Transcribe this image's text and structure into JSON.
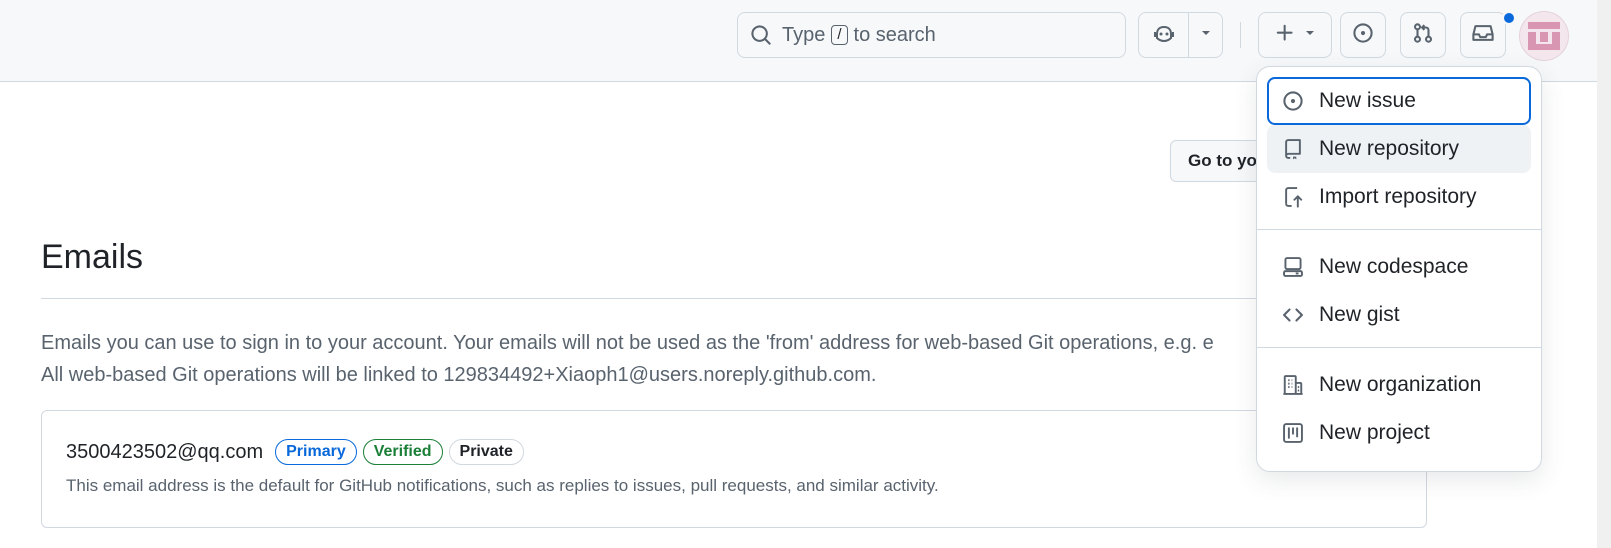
{
  "header": {
    "search": {
      "prefix": "Type",
      "key": "/",
      "suffix": "to search"
    }
  },
  "content": {
    "goto_button": "Go to yo",
    "title": "Emails",
    "description_line1": "Emails you can use to sign in to your account. Your emails will not be used as the 'from' address for web-based Git operations, e.g. e",
    "description_line2": "All web-based Git operations will be linked to 129834492+Xiaoph1@users.noreply.github.com.",
    "email": {
      "address": "3500423502@qq.com",
      "labels": [
        "Primary",
        "Verified",
        "Private"
      ],
      "note": "This email address is the default for GitHub notifications, such as replies to issues, pull requests, and similar activity."
    }
  },
  "menu": {
    "items": [
      {
        "label": "New issue",
        "icon": "issue-opened-icon"
      },
      {
        "label": "New repository",
        "icon": "repo-icon"
      },
      {
        "label": "Import repository",
        "icon": "repo-push-icon"
      },
      {
        "label": "New codespace",
        "icon": "codespaces-icon"
      },
      {
        "label": "New gist",
        "icon": "code-icon"
      },
      {
        "label": "New organization",
        "icon": "organization-icon"
      },
      {
        "label": "New project",
        "icon": "project-icon"
      }
    ]
  },
  "colors": {
    "accent": "#0969da",
    "success": "#1a7f37",
    "border": "#d1d9e0",
    "muted": "#59636e"
  }
}
